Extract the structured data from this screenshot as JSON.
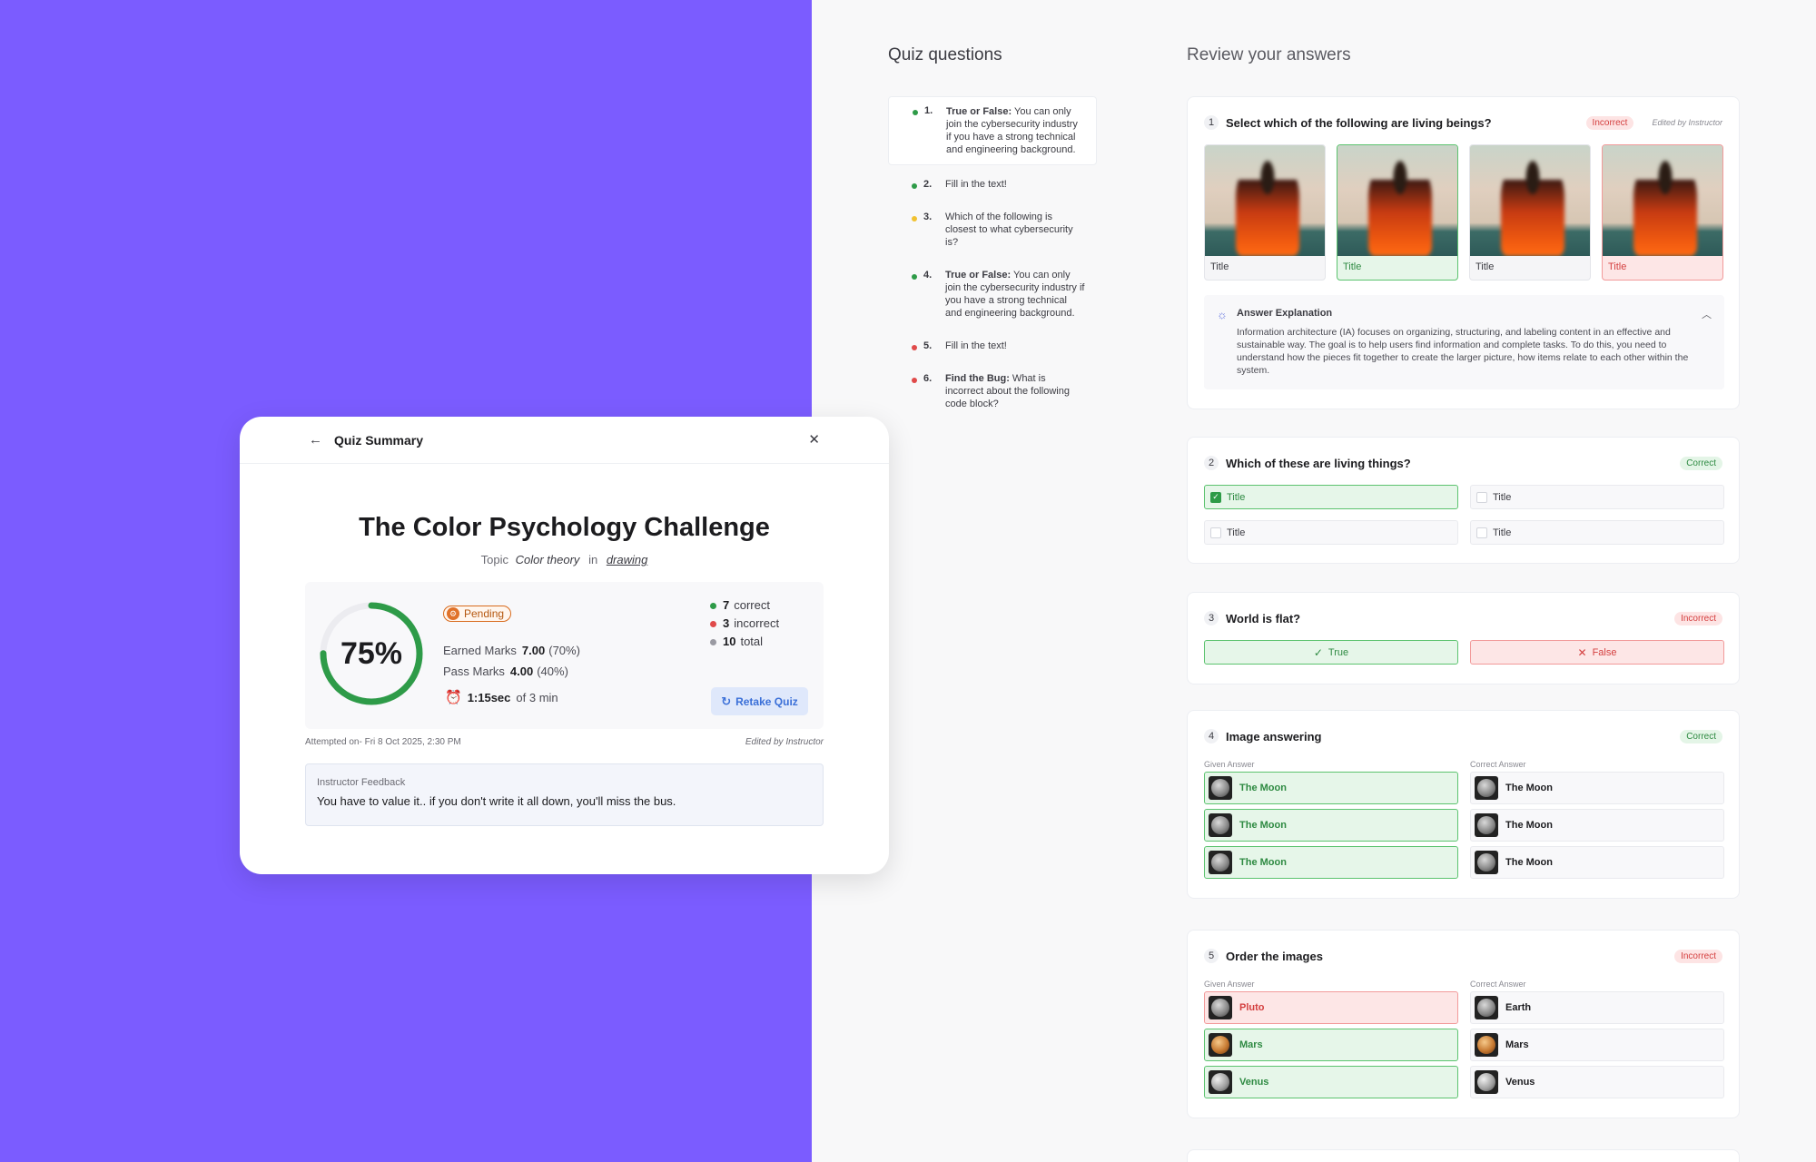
{
  "sidebar": {
    "title": "Quiz questions",
    "items": [
      {
        "num": "1.",
        "bold": "True or False:",
        "text": " You can only join the cybersecurity industry if you have a strong technical and engineering background.",
        "dot": "#2e9b48",
        "active": true
      },
      {
        "num": "2.",
        "bold": "",
        "text": "Fill in the text!",
        "dot": "#2e9b48"
      },
      {
        "num": "3.",
        "bold": "",
        "text": "Which of the following is closest to what cybersecurity is?",
        "dot": "#f1c232"
      },
      {
        "num": "4.",
        "bold": "True or False:",
        "text": " You can only join the cybersecurity industry if you have a strong technical and engineering background.",
        "dot": "#2e9b48"
      },
      {
        "num": "5.",
        "bold": "",
        "text": "Fill in the text!",
        "dot": "#e04a4a"
      },
      {
        "num": "6.",
        "bold": "Find the Bug:",
        "text": " What is incorrect about the following code block?",
        "dot": "#e04a4a"
      }
    ]
  },
  "review": {
    "title": "Review your answers",
    "q1": {
      "num": "1",
      "text": "Select which of the following are living beings?",
      "status": "Incorrect",
      "edited": "Edited by Instructor",
      "options": [
        "Title",
        "Title",
        "Title",
        "Title"
      ],
      "explanation_title": "Answer Explanation",
      "explanation": "Information architecture (IA) focuses on organizing, structuring, and labeling content in an effective and sustainable way. The goal is to help users find information and complete tasks. To do this, you need to understand how the pieces fit together to create the larger picture, how items relate to each other within the system."
    },
    "q2": {
      "num": "2",
      "text": "Which of these are living things?",
      "status": "Correct",
      "options": [
        "Title",
        "Title",
        "Title",
        "Title"
      ]
    },
    "q3": {
      "num": "3",
      "text": "World is flat?",
      "status": "Incorrect",
      "true_label": "True",
      "false_label": "False"
    },
    "q4": {
      "num": "4",
      "text": "Image answering",
      "status": "Correct",
      "given_head": "Given Answer",
      "correct_head": "Correct Answer",
      "given": [
        "The Moon",
        "The Moon",
        "The Moon"
      ],
      "correct": [
        "The Moon",
        "The Moon",
        "The Moon"
      ]
    },
    "q5": {
      "num": "5",
      "text": "Order the images",
      "status": "Incorrect",
      "given_head": "Given Answer",
      "correct_head": "Correct Answer",
      "given": [
        "Pluto",
        "Mars",
        "Venus"
      ],
      "correct": [
        "Earth",
        "Mars",
        "Venus"
      ]
    }
  },
  "summary": {
    "header": "Quiz Summary",
    "quiz_title": "The Color Psychology Challenge",
    "topic_label": "Topic",
    "topic": "Color theory",
    "in_label": "in",
    "category": "drawing",
    "score_pct": "75%",
    "score_value": 0.75,
    "status": "Pending",
    "earned_label": "Earned Marks",
    "earned": "7.00",
    "earned_pct": "(70%)",
    "pass_label": "Pass Marks",
    "pass": "4.00",
    "pass_pct": "(40%)",
    "time": "1:15sec",
    "time_of": "of 3 min",
    "correct_count": "7",
    "correct_label": "correct",
    "incorrect_count": "3",
    "incorrect_label": "incorrect",
    "total_count": "10",
    "total_label": "total",
    "retake": "Retake Quiz",
    "attempted": "Attempted on- Fri 8 Oct 2025, 2:30 PM",
    "edited": "Edited by Instructor",
    "feedback_title": "Instructor Feedback",
    "feedback": "You have to value it.. if you don't write it all down, you'll miss the bus."
  },
  "colors": {
    "accent": "#7b5cff",
    "correct": "#2e9b48",
    "incorrect": "#e04a4a",
    "pending": "#f1c232"
  }
}
